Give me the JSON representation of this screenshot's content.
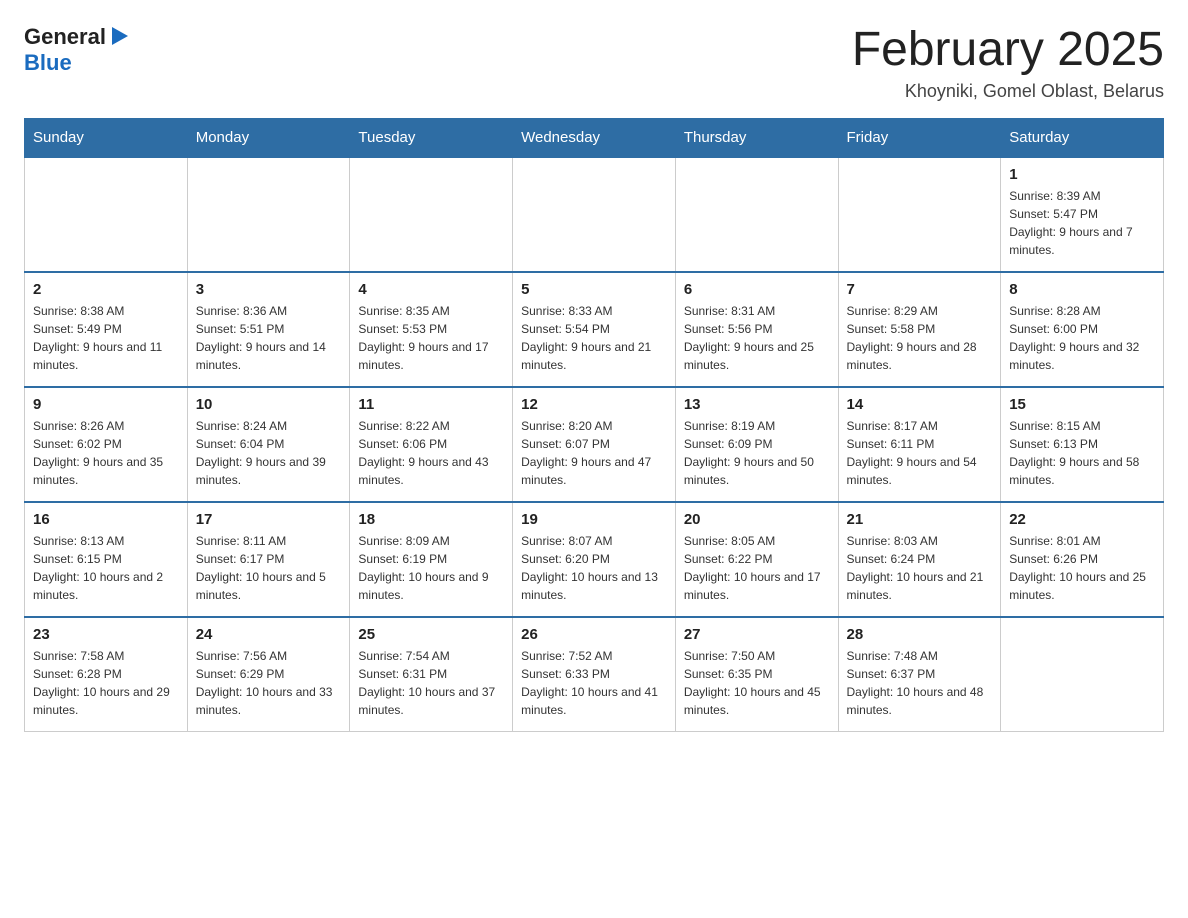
{
  "logo": {
    "general": "General",
    "blue": "Blue"
  },
  "header": {
    "month": "February 2025",
    "location": "Khoyniki, Gomel Oblast, Belarus"
  },
  "days_of_week": [
    "Sunday",
    "Monday",
    "Tuesday",
    "Wednesday",
    "Thursday",
    "Friday",
    "Saturday"
  ],
  "weeks": [
    {
      "days": [
        {
          "number": "",
          "info": ""
        },
        {
          "number": "",
          "info": ""
        },
        {
          "number": "",
          "info": ""
        },
        {
          "number": "",
          "info": ""
        },
        {
          "number": "",
          "info": ""
        },
        {
          "number": "",
          "info": ""
        },
        {
          "number": "1",
          "info": "Sunrise: 8:39 AM\nSunset: 5:47 PM\nDaylight: 9 hours and 7 minutes."
        }
      ]
    },
    {
      "days": [
        {
          "number": "2",
          "info": "Sunrise: 8:38 AM\nSunset: 5:49 PM\nDaylight: 9 hours and 11 minutes."
        },
        {
          "number": "3",
          "info": "Sunrise: 8:36 AM\nSunset: 5:51 PM\nDaylight: 9 hours and 14 minutes."
        },
        {
          "number": "4",
          "info": "Sunrise: 8:35 AM\nSunset: 5:53 PM\nDaylight: 9 hours and 17 minutes."
        },
        {
          "number": "5",
          "info": "Sunrise: 8:33 AM\nSunset: 5:54 PM\nDaylight: 9 hours and 21 minutes."
        },
        {
          "number": "6",
          "info": "Sunrise: 8:31 AM\nSunset: 5:56 PM\nDaylight: 9 hours and 25 minutes."
        },
        {
          "number": "7",
          "info": "Sunrise: 8:29 AM\nSunset: 5:58 PM\nDaylight: 9 hours and 28 minutes."
        },
        {
          "number": "8",
          "info": "Sunrise: 8:28 AM\nSunset: 6:00 PM\nDaylight: 9 hours and 32 minutes."
        }
      ]
    },
    {
      "days": [
        {
          "number": "9",
          "info": "Sunrise: 8:26 AM\nSunset: 6:02 PM\nDaylight: 9 hours and 35 minutes."
        },
        {
          "number": "10",
          "info": "Sunrise: 8:24 AM\nSunset: 6:04 PM\nDaylight: 9 hours and 39 minutes."
        },
        {
          "number": "11",
          "info": "Sunrise: 8:22 AM\nSunset: 6:06 PM\nDaylight: 9 hours and 43 minutes."
        },
        {
          "number": "12",
          "info": "Sunrise: 8:20 AM\nSunset: 6:07 PM\nDaylight: 9 hours and 47 minutes."
        },
        {
          "number": "13",
          "info": "Sunrise: 8:19 AM\nSunset: 6:09 PM\nDaylight: 9 hours and 50 minutes."
        },
        {
          "number": "14",
          "info": "Sunrise: 8:17 AM\nSunset: 6:11 PM\nDaylight: 9 hours and 54 minutes."
        },
        {
          "number": "15",
          "info": "Sunrise: 8:15 AM\nSunset: 6:13 PM\nDaylight: 9 hours and 58 minutes."
        }
      ]
    },
    {
      "days": [
        {
          "number": "16",
          "info": "Sunrise: 8:13 AM\nSunset: 6:15 PM\nDaylight: 10 hours and 2 minutes."
        },
        {
          "number": "17",
          "info": "Sunrise: 8:11 AM\nSunset: 6:17 PM\nDaylight: 10 hours and 5 minutes."
        },
        {
          "number": "18",
          "info": "Sunrise: 8:09 AM\nSunset: 6:19 PM\nDaylight: 10 hours and 9 minutes."
        },
        {
          "number": "19",
          "info": "Sunrise: 8:07 AM\nSunset: 6:20 PM\nDaylight: 10 hours and 13 minutes."
        },
        {
          "number": "20",
          "info": "Sunrise: 8:05 AM\nSunset: 6:22 PM\nDaylight: 10 hours and 17 minutes."
        },
        {
          "number": "21",
          "info": "Sunrise: 8:03 AM\nSunset: 6:24 PM\nDaylight: 10 hours and 21 minutes."
        },
        {
          "number": "22",
          "info": "Sunrise: 8:01 AM\nSunset: 6:26 PM\nDaylight: 10 hours and 25 minutes."
        }
      ]
    },
    {
      "days": [
        {
          "number": "23",
          "info": "Sunrise: 7:58 AM\nSunset: 6:28 PM\nDaylight: 10 hours and 29 minutes."
        },
        {
          "number": "24",
          "info": "Sunrise: 7:56 AM\nSunset: 6:29 PM\nDaylight: 10 hours and 33 minutes."
        },
        {
          "number": "25",
          "info": "Sunrise: 7:54 AM\nSunset: 6:31 PM\nDaylight: 10 hours and 37 minutes."
        },
        {
          "number": "26",
          "info": "Sunrise: 7:52 AM\nSunset: 6:33 PM\nDaylight: 10 hours and 41 minutes."
        },
        {
          "number": "27",
          "info": "Sunrise: 7:50 AM\nSunset: 6:35 PM\nDaylight: 10 hours and 45 minutes."
        },
        {
          "number": "28",
          "info": "Sunrise: 7:48 AM\nSunset: 6:37 PM\nDaylight: 10 hours and 48 minutes."
        },
        {
          "number": "",
          "info": ""
        }
      ]
    }
  ]
}
